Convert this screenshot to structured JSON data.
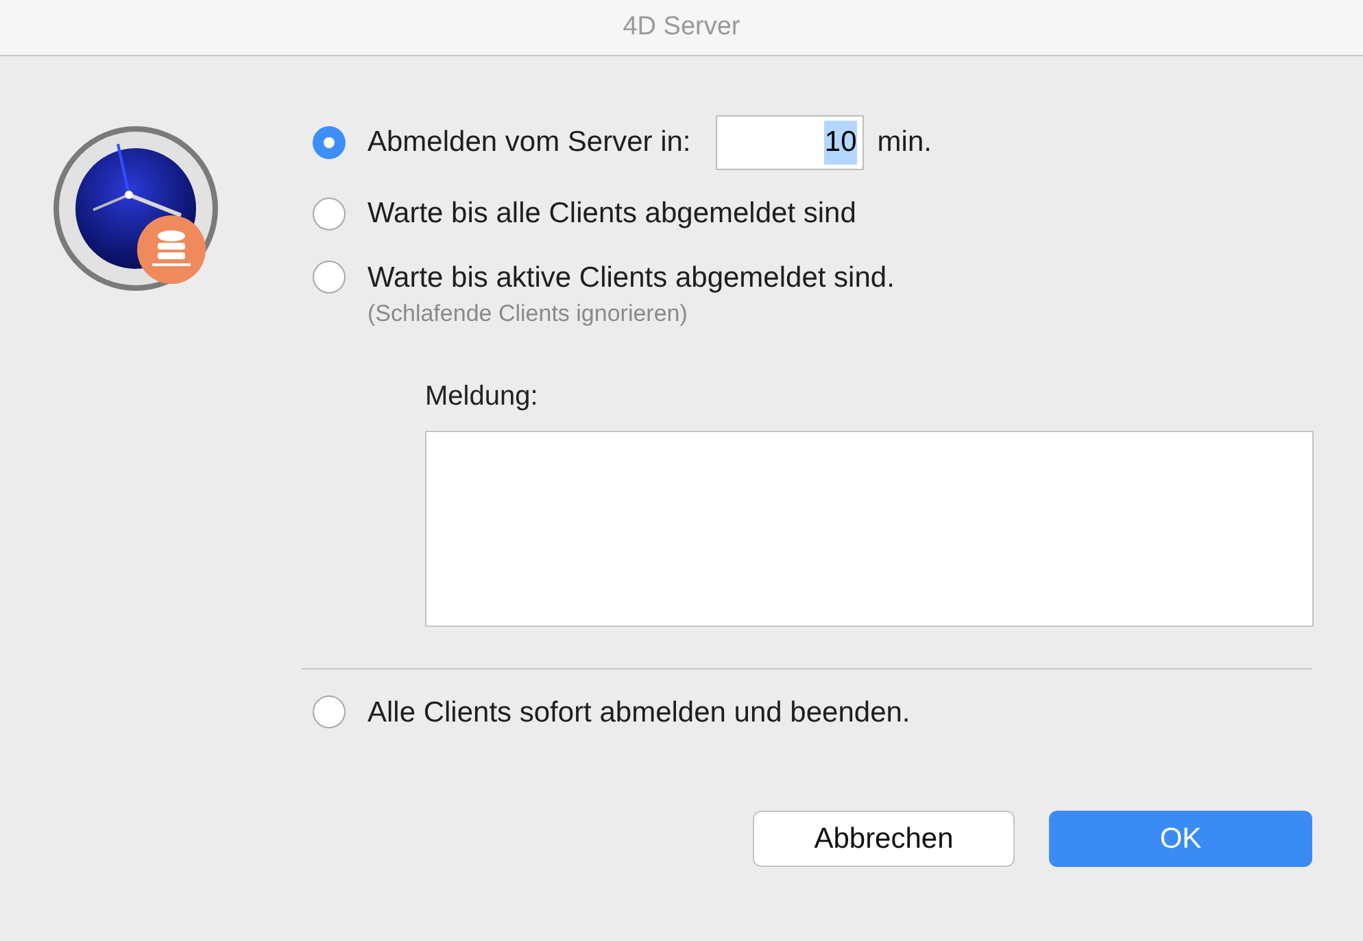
{
  "window": {
    "title": "4D Server"
  },
  "options": [
    {
      "kind": "timed",
      "label": "Abmelden vom Server in:",
      "selected": true,
      "value": "10",
      "text_selected": true,
      "unit": "min."
    },
    {
      "kind": "plain",
      "label": "Warte bis alle Clients abgemeldet sind",
      "selected": false
    },
    {
      "kind": "plain",
      "label": "Warte bis aktive Clients abgemeldet sind.",
      "note": "(Schlafende Clients ignorieren)",
      "selected": false
    },
    {
      "kind": "immediate",
      "label": "Alle Clients sofort abmelden und beenden.",
      "selected": false
    }
  ],
  "message": {
    "label": "Meldung:"
  },
  "buttons": [
    {
      "label": "Abbrechen",
      "default": false
    },
    {
      "label": "OK",
      "default": true
    }
  ]
}
